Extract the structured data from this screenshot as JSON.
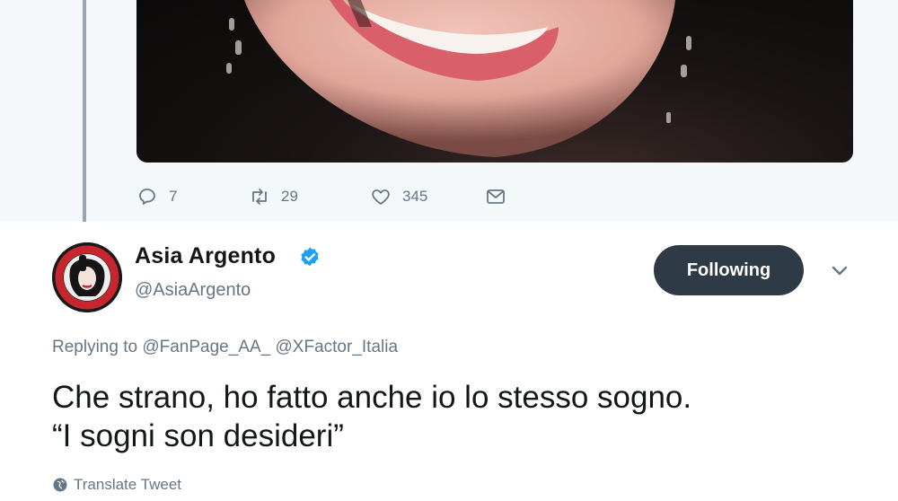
{
  "previous_tweet": {
    "media": {
      "description_icon": "photo-smile-closeup"
    },
    "actions": {
      "replies": "7",
      "retweets": "29",
      "likes": "345"
    }
  },
  "tweet": {
    "author": {
      "display_name": "Asia Argento",
      "handle": "@AsiaArgento",
      "verified": true
    },
    "follow_button_label": "Following",
    "replying_prefix": "Replying to",
    "replying_to": [
      "@FanPage_AA_",
      "@XFactor_Italia"
    ],
    "text_lines": [
      "Che strano, ho fatto anche io lo stesso sogno.",
      "“I sogni son desideri”"
    ],
    "translate_label": "Translate Tweet"
  },
  "colors": {
    "background_thread": "#f5f8fa",
    "secondary_text": "#657786",
    "verified_blue": "#1da1f2",
    "follow_button_bg": "#2e3a45"
  }
}
